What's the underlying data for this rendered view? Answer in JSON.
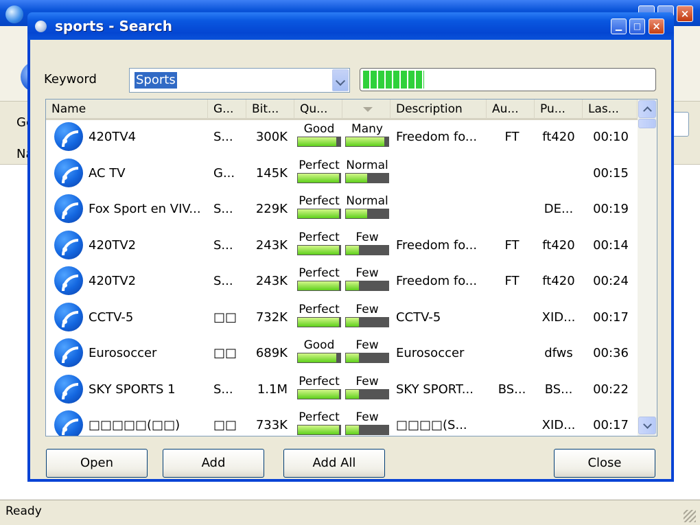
{
  "statusbar": {
    "text": "Ready"
  },
  "background": {
    "panel_label_1": "Ge",
    "panel_label_2": "Na"
  },
  "dialog": {
    "title": "sports - Search",
    "keyword_label": "Keyword",
    "keyword_value": "Sports",
    "progress_fraction": 0.21
  },
  "list": {
    "headers": [
      "Name",
      "G...",
      "Bit...",
      "Qu...",
      "",
      "Description",
      "Au...",
      "Pu...",
      "Las..."
    ],
    "rows": [
      {
        "name": "420TV4",
        "genre": "S...",
        "bitrate": "300K",
        "quality": "Good",
        "quality_level": 0.9,
        "peers": "Many",
        "peers_level": 0.9,
        "description": "Freedom fo...",
        "author": "FT",
        "publisher": "ft420",
        "last": "00:10"
      },
      {
        "name": "AC TV",
        "genre": "G...",
        "bitrate": "145K",
        "quality": "Perfect",
        "quality_level": 0.97,
        "peers": "Normal",
        "peers_level": 0.5,
        "description": "",
        "author": "",
        "publisher": "",
        "last": "00:15"
      },
      {
        "name": "Fox Sport en VIV...",
        "genre": "S...",
        "bitrate": "229K",
        "quality": "Perfect",
        "quality_level": 0.97,
        "peers": "Normal",
        "peers_level": 0.5,
        "description": "",
        "author": "",
        "publisher": "DE...",
        "last": "00:19"
      },
      {
        "name": "420TV2",
        "genre": "S...",
        "bitrate": "243K",
        "quality": "Perfect",
        "quality_level": 0.97,
        "peers": "Few",
        "peers_level": 0.3,
        "description": "Freedom fo...",
        "author": "FT",
        "publisher": "ft420",
        "last": "00:14"
      },
      {
        "name": "420TV2",
        "genre": "S...",
        "bitrate": "243K",
        "quality": "Perfect",
        "quality_level": 0.97,
        "peers": "Few",
        "peers_level": 0.3,
        "description": "Freedom fo...",
        "author": "FT",
        "publisher": "ft420",
        "last": "00:24"
      },
      {
        "name": "CCTV-5",
        "genre": "□□",
        "bitrate": "732K",
        "quality": "Perfect",
        "quality_level": 0.97,
        "peers": "Few",
        "peers_level": 0.3,
        "description": "CCTV-5",
        "author": "",
        "publisher": "XID...",
        "last": "00:17"
      },
      {
        "name": "Eurosoccer",
        "genre": "□□",
        "bitrate": "689K",
        "quality": "Good",
        "quality_level": 0.9,
        "peers": "Few",
        "peers_level": 0.3,
        "description": "Eurosoccer",
        "author": "",
        "publisher": "dfws",
        "last": "00:36"
      },
      {
        "name": "SKY SPORTS 1",
        "genre": "S...",
        "bitrate": "1.1M",
        "quality": "Perfect",
        "quality_level": 0.97,
        "peers": "Few",
        "peers_level": 0.3,
        "description": "SKY SPORT...",
        "author": "BS...",
        "publisher": "BS...",
        "last": "00:22"
      },
      {
        "name": "□□□□□(□□)",
        "genre": "□□",
        "bitrate": "733K",
        "quality": "Perfect",
        "quality_level": 0.97,
        "peers": "Few",
        "peers_level": 0.3,
        "description": "□□□□(S...",
        "author": "",
        "publisher": "XID...",
        "last": "00:17"
      }
    ]
  },
  "buttons": {
    "open": "Open",
    "add": "Add",
    "add_all": "Add All",
    "close": "Close"
  }
}
